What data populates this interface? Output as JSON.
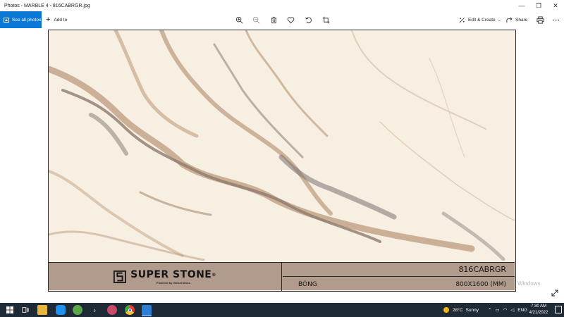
{
  "window": {
    "title": "Photos - MARBLE 4 - 816CABRGR.jpg",
    "controls": {
      "minimize": "—",
      "maximize": "❐",
      "close": "✕"
    }
  },
  "toolbar": {
    "see_all_photos": "See all photos",
    "add_to": "Add to",
    "tools": [
      "zoom-in-icon",
      "zoom-out-icon",
      "delete-icon",
      "favorite-icon",
      "rotate-icon",
      "crop-icon"
    ],
    "edit_create": "Edit & Create",
    "share": "Share",
    "accent_color": "#0a78d4"
  },
  "photo": {
    "brand_name": "SUPER STONE",
    "brand_mark": "®",
    "powered_by": "Powered by Vietceramics",
    "product_code": "816CABRGR",
    "finish": "BÓNG",
    "size": "800X1600 (MM)",
    "label_color": "#b09b8c"
  },
  "overlay": {
    "activation_watermark": "Windows."
  },
  "taskbar": {
    "apps": [
      "start-icon",
      "task-view-icon",
      "file-explorer-icon",
      "zalo-icon",
      "coccoc-icon",
      "tiktok-icon",
      "paint-icon",
      "chrome-icon",
      "photos-icon"
    ],
    "weather_temp": "28°C",
    "weather_text": "Sunny",
    "language": "ENG",
    "time": "7:30 AM",
    "date": "4/21/2022"
  }
}
